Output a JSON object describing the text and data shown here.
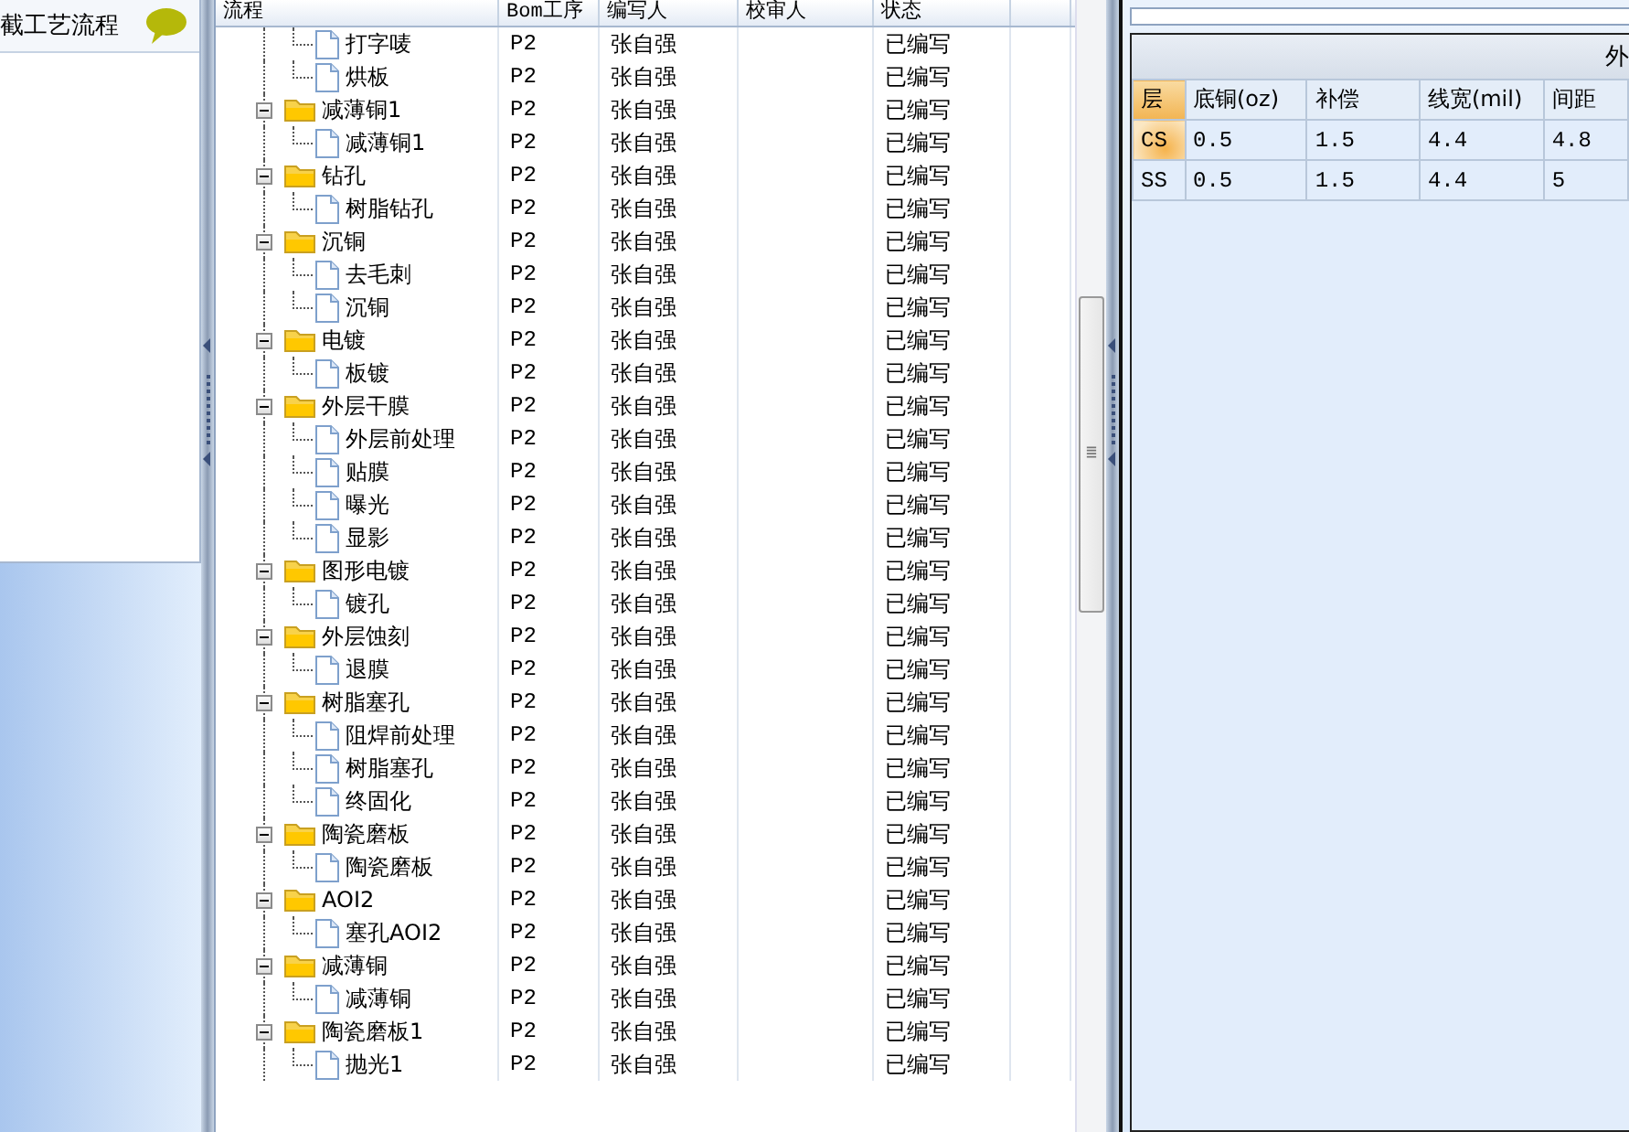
{
  "side_panel": {
    "title": "截工艺流程"
  },
  "tree_grid": {
    "columns": [
      "流程",
      "Bom工序",
      "编写人",
      "校审人",
      "状态"
    ],
    "rows": [
      {
        "kind": "leaf",
        "name": "打字唛",
        "bom": "P2",
        "writer": "张自强",
        "status": "已编写"
      },
      {
        "kind": "leaf",
        "name": "烘板",
        "bom": "P2",
        "writer": "张自强",
        "status": "已编写"
      },
      {
        "kind": "group",
        "expanded": true,
        "name": "减薄铜1",
        "bom": "P2",
        "writer": "张自强",
        "status": "已编写",
        "children": [
          {
            "kind": "leaf",
            "name": "减薄铜1",
            "bom": "P2",
            "writer": "张自强",
            "status": "已编写"
          }
        ]
      },
      {
        "kind": "group",
        "expanded": true,
        "name": "钻孔",
        "bom": "P2",
        "writer": "张自强",
        "status": "已编写",
        "children": [
          {
            "kind": "leaf",
            "name": "树脂钻孔",
            "bom": "P2",
            "writer": "张自强",
            "status": "已编写"
          }
        ]
      },
      {
        "kind": "group",
        "expanded": true,
        "name": "沉铜",
        "bom": "P2",
        "writer": "张自强",
        "status": "已编写",
        "children": [
          {
            "kind": "leaf",
            "name": "去毛刺",
            "bom": "P2",
            "writer": "张自强",
            "status": "已编写"
          },
          {
            "kind": "leaf",
            "name": "沉铜",
            "bom": "P2",
            "writer": "张自强",
            "status": "已编写"
          }
        ]
      },
      {
        "kind": "group",
        "expanded": true,
        "name": "电镀",
        "bom": "P2",
        "writer": "张自强",
        "status": "已编写",
        "children": [
          {
            "kind": "leaf",
            "name": "板镀",
            "bom": "P2",
            "writer": "张自强",
            "status": "已编写"
          }
        ]
      },
      {
        "kind": "group",
        "expanded": true,
        "name": "外层干膜",
        "bom": "P2",
        "writer": "张自强",
        "status": "已编写",
        "children": [
          {
            "kind": "leaf",
            "name": "外层前处理",
            "bom": "P2",
            "writer": "张自强",
            "status": "已编写"
          },
          {
            "kind": "leaf",
            "name": "贴膜",
            "bom": "P2",
            "writer": "张自强",
            "status": "已编写"
          },
          {
            "kind": "leaf",
            "name": "曝光",
            "bom": "P2",
            "writer": "张自强",
            "status": "已编写"
          },
          {
            "kind": "leaf",
            "name": "显影",
            "bom": "P2",
            "writer": "张自强",
            "status": "已编写"
          }
        ]
      },
      {
        "kind": "group",
        "expanded": true,
        "name": "图形电镀",
        "bom": "P2",
        "writer": "张自强",
        "status": "已编写",
        "children": [
          {
            "kind": "leaf",
            "name": "镀孔",
            "bom": "P2",
            "writer": "张自强",
            "status": "已编写"
          }
        ]
      },
      {
        "kind": "group",
        "expanded": true,
        "name": "外层蚀刻",
        "bom": "P2",
        "writer": "张自强",
        "status": "已编写",
        "children": [
          {
            "kind": "leaf",
            "name": "退膜",
            "bom": "P2",
            "writer": "张自强",
            "status": "已编写"
          }
        ]
      },
      {
        "kind": "group",
        "expanded": true,
        "name": "树脂塞孔",
        "bom": "P2",
        "writer": "张自强",
        "status": "已编写",
        "children": [
          {
            "kind": "leaf",
            "name": "阻焊前处理",
            "bom": "P2",
            "writer": "张自强",
            "status": "已编写"
          },
          {
            "kind": "leaf",
            "name": "树脂塞孔",
            "bom": "P2",
            "writer": "张自强",
            "status": "已编写"
          },
          {
            "kind": "leaf",
            "name": "终固化",
            "bom": "P2",
            "writer": "张自强",
            "status": "已编写"
          }
        ]
      },
      {
        "kind": "group",
        "expanded": true,
        "name": "陶瓷磨板",
        "bom": "P2",
        "writer": "张自强",
        "status": "已编写",
        "children": [
          {
            "kind": "leaf",
            "name": "陶瓷磨板",
            "bom": "P2",
            "writer": "张自强",
            "status": "已编写"
          }
        ]
      },
      {
        "kind": "group",
        "expanded": true,
        "name": "AOI2",
        "bom": "P2",
        "writer": "张自强",
        "status": "已编写",
        "children": [
          {
            "kind": "leaf",
            "name": "塞孔AOI2",
            "bom": "P2",
            "writer": "张自强",
            "status": "已编写"
          }
        ]
      },
      {
        "kind": "group",
        "expanded": true,
        "name": "减薄铜",
        "bom": "P2",
        "writer": "张自强",
        "status": "已编写",
        "children": [
          {
            "kind": "leaf",
            "name": "减薄铜",
            "bom": "P2",
            "writer": "张自强",
            "status": "已编写"
          }
        ]
      },
      {
        "kind": "group",
        "expanded": true,
        "name": "陶瓷磨板1",
        "bom": "P2",
        "writer": "张自强",
        "status": "已编写",
        "children": [
          {
            "kind": "leaf",
            "name": "抛光1",
            "bom": "P2",
            "writer": "张自强",
            "status": "已编写"
          }
        ]
      }
    ]
  },
  "layer_panel": {
    "title": "外",
    "columns": [
      "层",
      "底铜(oz)",
      "补偿",
      "线宽(mil)",
      "间距"
    ],
    "rows": [
      {
        "selected": true,
        "cells": [
          "CS",
          "0.5",
          "1.5",
          "4.4",
          "4.8"
        ]
      },
      {
        "selected": false,
        "cells": [
          "SS",
          "0.5",
          "1.5",
          "4.4",
          "5"
        ]
      }
    ]
  }
}
